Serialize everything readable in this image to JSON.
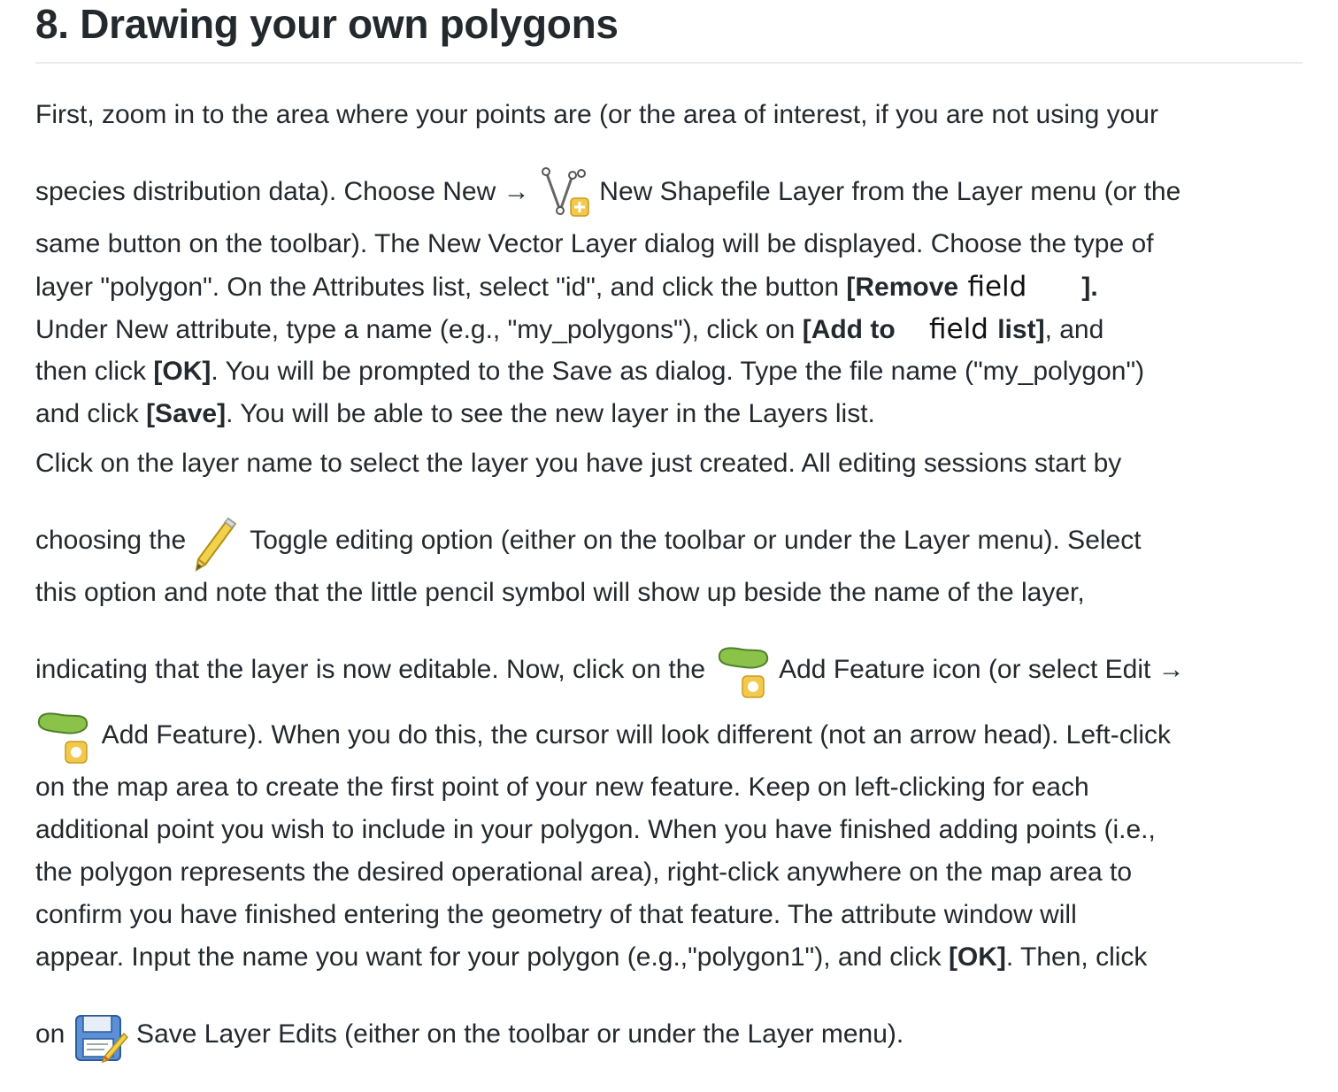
{
  "title": "8. Drawing your own polygons",
  "p1": {
    "l1": "First, zoom in to the area where your points are (or the area of interest, if you are not using your",
    "l2a": "species distribution data). Choose New → ",
    "l2b": " New Shapefile Layer from the Layer menu (or the",
    "l3": "same button on the toolbar). The New Vector Layer dialog will be displayed. Choose the type of",
    "l4a": "layer \"polygon\". On the Attributes list, select \"id\", and click the button ",
    "l4b": "[Remove ",
    "l4c": "field",
    "l4d": "].",
    "l5a": "Under New attribute, type a name (e.g., \"my_polygons\"), click on ",
    "l5b": "[Add to ",
    "l5c": "field",
    "l5d": " list]",
    "l5e": ", and",
    "l6a": "then click ",
    "l6b": "[OK]",
    "l6c": ". You will be prompted to the Save as dialog. Type the file name (\"my_polygon\")",
    "l7a": "and click ",
    "l7b": "[Save]",
    "l7c": ". You will be able to see the new layer in the Layers list."
  },
  "p2": {
    "l1": "Click on the layer name to select the layer you have just created. All editing sessions start by",
    "l2a": "choosing the ",
    "l2b": " Toggle editing option (either on the toolbar or under the Layer menu). Select",
    "l3": "this option and note that the little pencil symbol will show up beside the name of the layer,",
    "l4a": "indicating that the layer is now editable. Now, click on the ",
    "l4b": " Add Feature icon (or select Edit →",
    "l5a": " Add Feature). When you do this, the cursor will look different (not an arrow head). Left-click",
    "l6": "on the map area to create the first point of your new feature. Keep on left-clicking for each",
    "l7": "additional point you wish to include in your polygon. When you have finished adding points (i.e.,",
    "l8": "the polygon represents the desired operational area), right-click anywhere on the map area to",
    "l9": "confirm you have finished entering the geometry of that feature. The attribute window will",
    "l10a": "appear. Input the name you want for your polygon (e.g.,\"polygon1\"), and click ",
    "l10b": "[OK]",
    "l10c": ". Then, click",
    "l11a": "on ",
    "l11b": " Save Layer Edits (either on the toolbar or under the Layer menu)."
  }
}
